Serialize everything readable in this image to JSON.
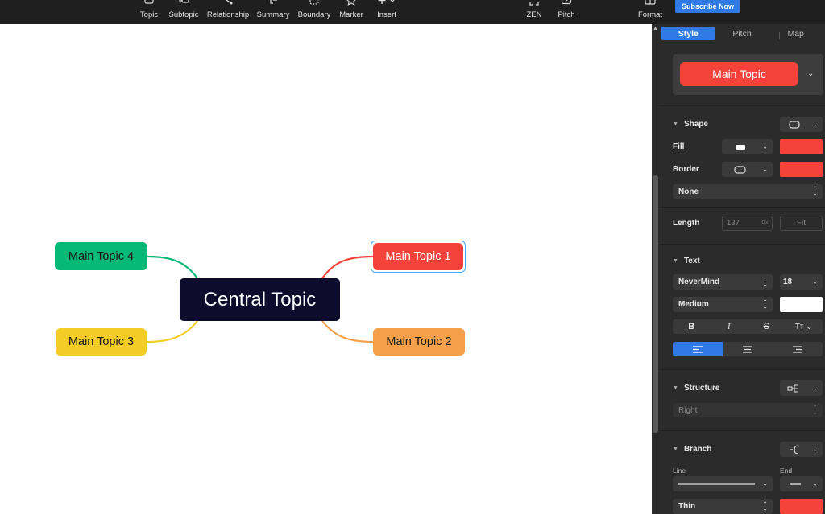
{
  "toolbar": {
    "items": [
      {
        "label": "Topic",
        "icon": "topic-icon"
      },
      {
        "label": "Subtopic",
        "icon": "subtopic-icon"
      },
      {
        "label": "Relationship",
        "icon": "relationship-icon"
      },
      {
        "label": "Summary",
        "icon": "summary-icon"
      },
      {
        "label": "Boundary",
        "icon": "boundary-icon"
      },
      {
        "label": "Marker",
        "icon": "star-icon"
      },
      {
        "label": "Insert",
        "icon": "plus-icon"
      },
      {
        "label": "ZEN",
        "icon": "expand-icon"
      },
      {
        "label": "Pitch",
        "icon": "play-icon"
      },
      {
        "label": "Format",
        "icon": "format-icon"
      }
    ],
    "subscribe_label": "Subscribe Now"
  },
  "canvas": {
    "central_topic": "Central Topic",
    "main_topic_1": "Main Topic 1",
    "main_topic_2": "Main Topic 2",
    "main_topic_3": "Main Topic 3",
    "main_topic_4": "Main Topic 4",
    "colors": {
      "central": "#0e0c2c",
      "mt1": "#f5433c",
      "mt2": "#f5a04a",
      "mt3": "#f3cd26",
      "mt4": "#06b977",
      "selection": "#4aa8f0"
    }
  },
  "panel": {
    "tabs": [
      "Style",
      "Pitch",
      "Map"
    ],
    "active_tab": "Style",
    "preview_label": "Main Topic",
    "shape": {
      "title": "Shape",
      "fill_label": "Fill",
      "fill_color": "#f5433c",
      "border_label": "Border",
      "border_color": "#f5433c",
      "border_style": "None",
      "length_label": "Length",
      "length_placeholder": "137",
      "length_unit": "PX",
      "fit_label": "Fit"
    },
    "text": {
      "title": "Text",
      "font": "NeverMind",
      "size": "18",
      "weight": "Medium",
      "color": "#ffffff"
    },
    "structure": {
      "title": "Structure",
      "value": "Right"
    },
    "branch": {
      "title": "Branch",
      "line_label": "Line",
      "end_label": "End",
      "thickness": "Thin",
      "color": "#f5433c"
    }
  }
}
